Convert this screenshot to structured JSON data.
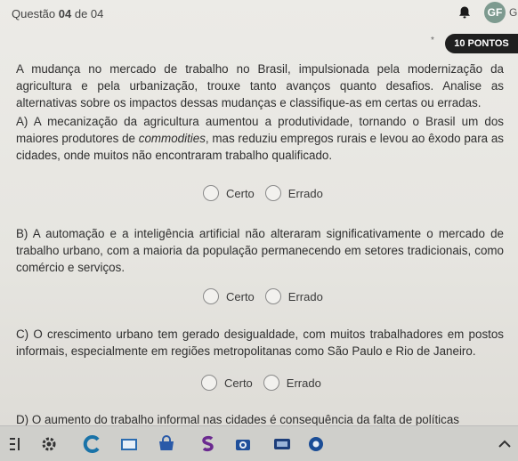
{
  "header": {
    "question_prefix": "Questão ",
    "question_num": "04",
    "question_suffix": " de 04",
    "avatar_initials": "GF",
    "avatar_cut": "G"
  },
  "points": {
    "star": "*",
    "label": "10 PONTOS"
  },
  "statement": "A mudança no mercado de trabalho no Brasil, impulsionada pela modernização da agricultura e pela urbanização, trouxe tanto avanços quanto desafios. Analise as alternativas sobre os impactos dessas mudanças e classifique-as em certas ou erradas.",
  "alternatives": [
    {
      "pre": "A) A mecanização da agricultura aumentou a produtividade, tornando o Brasil um dos maiores produtores de ",
      "italic": "commodities",
      "post": ", mas reduziu empregos rurais e levou ao êxodo para as cidades, onde muitos não encontraram trabalho qualificado."
    },
    {
      "pre": "B) A automação e a inteligência artificial não alteraram significativamente o mercado de trabalho urbano, com a maioria da população permanecendo em setores tradicionais, como comércio e serviços.",
      "italic": "",
      "post": ""
    },
    {
      "pre": "C) O crescimento urbano tem gerado desigualdade, com muitos trabalhadores em postos informais, especialmente em regiões metropolitanas como São Paulo e Rio de Janeiro.",
      "italic": "",
      "post": ""
    },
    {
      "pre": "D) O aumento do trabalho informal nas cidades é consequência da falta de políticas",
      "italic": "",
      "post": ""
    }
  ],
  "options": {
    "certo": "Certo",
    "errado": "Errado"
  }
}
